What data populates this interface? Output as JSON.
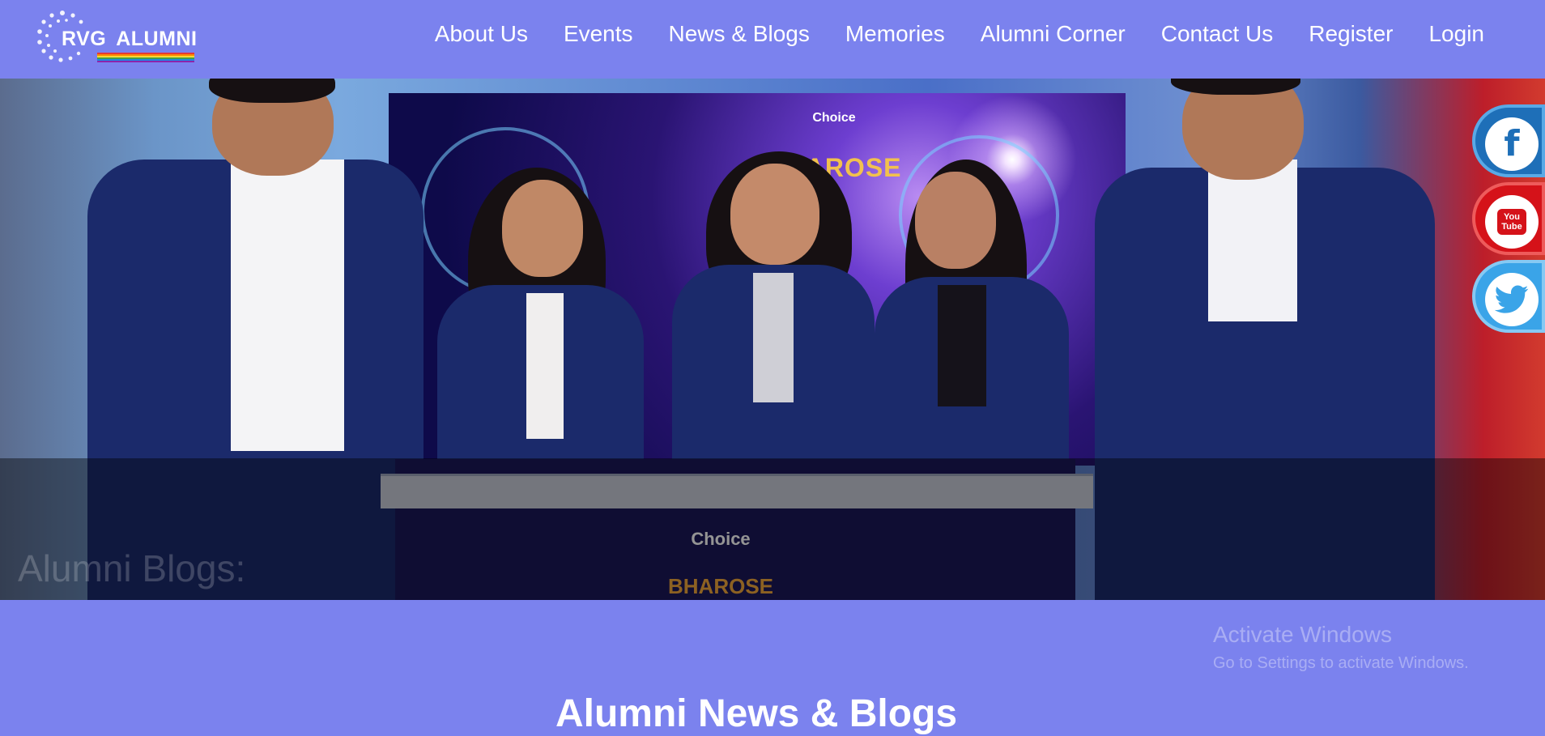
{
  "brand": {
    "logo_main": "RVG",
    "logo_sub": "ALUMNI",
    "stripe_colors": [
      "#e53935",
      "#fb8c00",
      "#fdd835",
      "#43a047",
      "#1e88e5",
      "#8e24aa"
    ]
  },
  "nav": {
    "items": [
      {
        "label": "About Us"
      },
      {
        "label": "Events"
      },
      {
        "label": "News & Blogs"
      },
      {
        "label": "Memories"
      },
      {
        "label": "Alumni Corner"
      },
      {
        "label": "Contact Us"
      },
      {
        "label": "Register"
      },
      {
        "label": "Login"
      }
    ]
  },
  "hero": {
    "caption": "Alumni Blogs:",
    "backdrop_brand": "Choice",
    "backdrop_word": "BHAROSE",
    "counter_brand": "Choice",
    "counter_word": "BHAROSE"
  },
  "social": {
    "facebook_icon": "facebook-icon",
    "youtube_icon": "youtube-icon",
    "twitter_icon": "twitter-icon",
    "facebook_glyph": "f",
    "youtube_glyph_1": "You",
    "youtube_glyph_2": "Tube"
  },
  "watermark": {
    "title": "Activate Windows",
    "subtitle": "Go to Settings to activate Windows."
  },
  "section": {
    "title": "Alumni News & Blogs"
  },
  "colors": {
    "page_background": "#7b82ee",
    "facebook": "#1e6fb8",
    "youtube": "#d51219",
    "twitter": "#3aa4e8"
  }
}
